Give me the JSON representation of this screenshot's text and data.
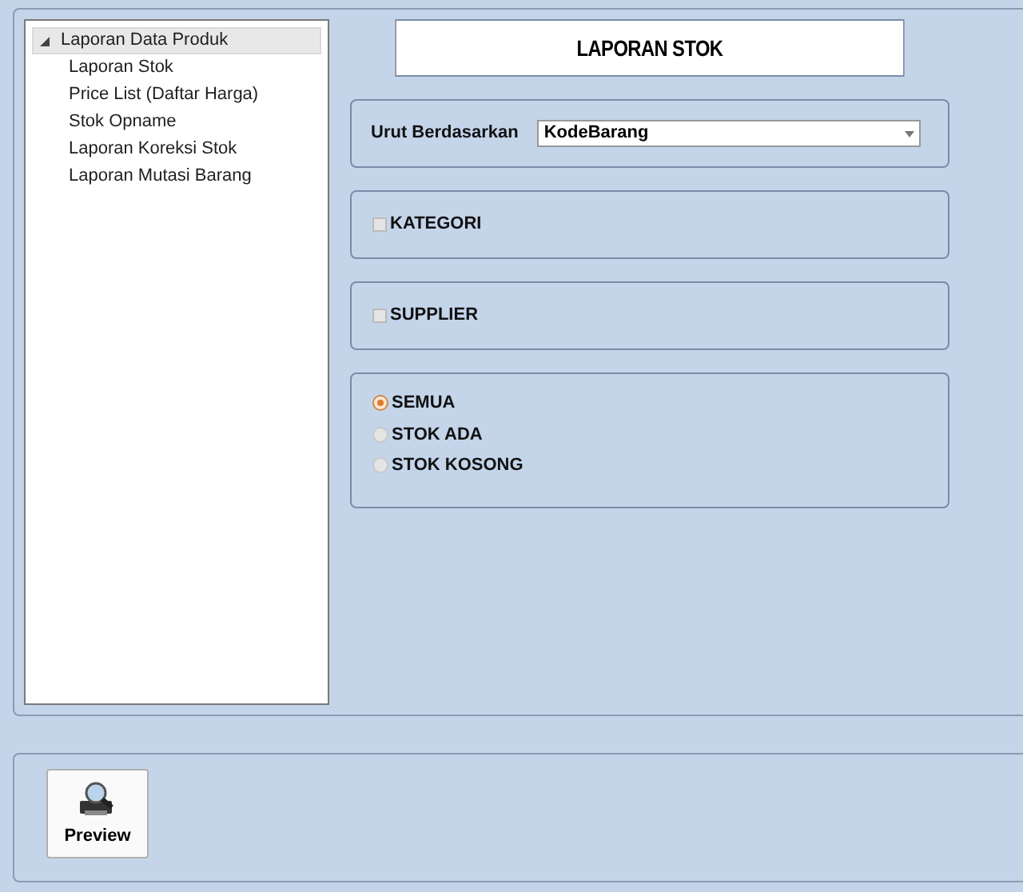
{
  "tree": [
    {
      "label": "Laporan Data Produk",
      "expanded": true,
      "selected": true,
      "children": [
        {
          "label": "Laporan Stok",
          "selected": false
        },
        {
          "label": "Price List (Daftar Harga)",
          "selected": false
        },
        {
          "label": "Stok Opname",
          "selected": false
        },
        {
          "label": "Laporan Koreksi Stok",
          "selected": false
        },
        {
          "label": "Laporan Mutasi Barang",
          "selected": false
        }
      ]
    }
  ],
  "title": "LAPORAN STOK",
  "sort": {
    "label": "Urut Berdasarkan",
    "value": "KodeBarang"
  },
  "filters": [
    {
      "label": "KATEGORI",
      "checked": false
    },
    {
      "label": "SUPPLIER",
      "checked": false
    }
  ],
  "stock_options": [
    {
      "label": "SEMUA",
      "selected": true
    },
    {
      "label": "STOK ADA",
      "selected": false
    },
    {
      "label": "STOK KOSONG",
      "selected": false
    }
  ],
  "preview_button": "Preview"
}
